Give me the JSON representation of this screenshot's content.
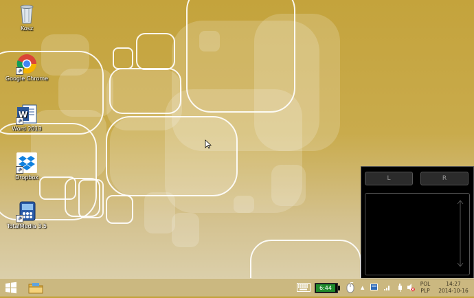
{
  "desktop": {
    "icons": [
      {
        "label": "Kosz",
        "icon": "recycle-bin-icon"
      },
      {
        "label": "Google Chrome",
        "icon": "chrome-icon"
      },
      {
        "label": "Word 2013",
        "icon": "word-icon"
      },
      {
        "label": "Dropbox",
        "icon": "dropbox-icon"
      },
      {
        "label": "TotalMedia 3.5",
        "icon": "totalmedia-icon"
      }
    ]
  },
  "touchpad": {
    "left_label": "L",
    "right_label": "R"
  },
  "taskbar": {
    "battery_time": "6:44",
    "language_top": "POL",
    "language_bottom": "PLP",
    "clock_time": "14:27",
    "clock_date": "2014-10-16"
  },
  "colors": {
    "wallpaper": "#c4a33c",
    "battery_green": "#1f8a2c",
    "taskbar": "#c8b478"
  }
}
